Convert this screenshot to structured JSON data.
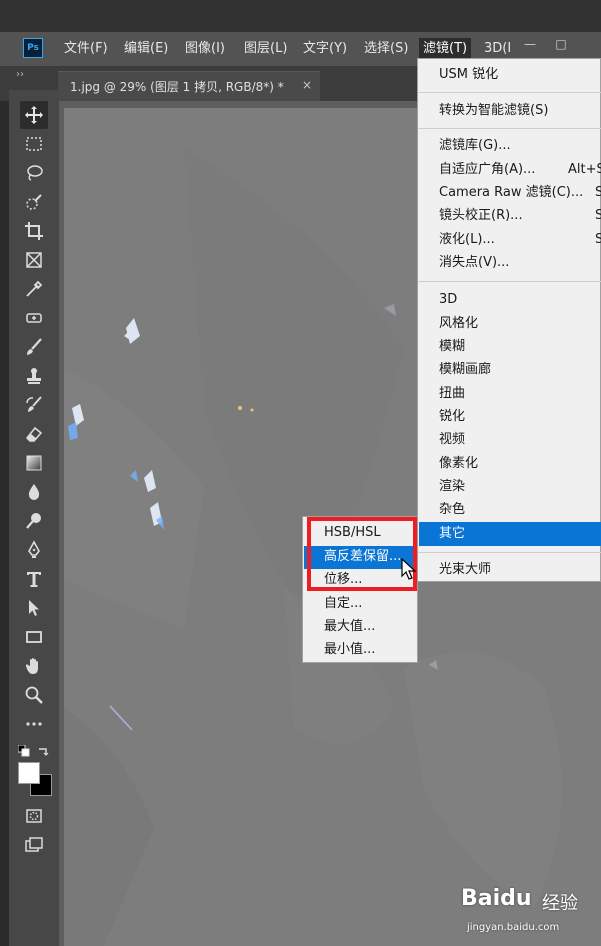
{
  "app": {
    "logo": "Ps",
    "menubar": [
      {
        "label": "文件(F)"
      },
      {
        "label": "编辑(E)"
      },
      {
        "label": "图像(I)"
      },
      {
        "label": "图层(L)"
      },
      {
        "label": "文字(Y)"
      },
      {
        "label": "选择(S)"
      },
      {
        "label": "滤镜(T)"
      },
      {
        "label": "3D(I"
      }
    ],
    "window_buttons": {
      "minimize": "—",
      "restore": "□"
    },
    "collapse_glyph": "››"
  },
  "document_tab": {
    "title": "1.jpg @ 29% (图层 1 拷贝, RGB/8*) *",
    "close": "×"
  },
  "toolbar": {
    "tools": [
      {
        "name": "move-tool-icon",
        "selected": true
      },
      {
        "name": "marquee-tool-icon"
      },
      {
        "name": "lasso-tool-icon"
      },
      {
        "name": "quick-select-tool-icon"
      },
      {
        "name": "crop-tool-icon"
      },
      {
        "name": "frame-tool-icon"
      },
      {
        "name": "eyedropper-tool-icon"
      },
      {
        "name": "healing-brush-tool-icon"
      },
      {
        "name": "brush-tool-icon"
      },
      {
        "name": "clone-stamp-tool-icon"
      },
      {
        "name": "history-brush-tool-icon"
      },
      {
        "name": "eraser-tool-icon"
      },
      {
        "name": "gradient-tool-icon"
      },
      {
        "name": "blur-tool-icon"
      },
      {
        "name": "dodge-tool-icon"
      },
      {
        "name": "pen-tool-icon"
      },
      {
        "name": "type-tool-icon"
      },
      {
        "name": "path-select-tool-icon"
      },
      {
        "name": "rectangle-tool-icon"
      },
      {
        "name": "hand-tool-icon"
      },
      {
        "name": "zoom-tool-icon"
      },
      {
        "name": "more-tools-icon"
      }
    ],
    "colors": {
      "foreground": "#ffffff",
      "background": "#000000"
    }
  },
  "filter_menu": {
    "items": [
      {
        "label": "USM 锐化"
      },
      {
        "label": "转换为智能滤镜(S)"
      },
      {
        "label": "滤镜库(G)..."
      },
      {
        "label": "自适应广角(A)...",
        "shortcut": "Alt+S"
      },
      {
        "label": "Camera Raw 滤镜(C)...",
        "shortcut": "S"
      },
      {
        "label": "镜头校正(R)...",
        "shortcut": "S"
      },
      {
        "label": "液化(L)...",
        "shortcut": "S"
      },
      {
        "label": "消失点(V)..."
      },
      {
        "label": "3D"
      },
      {
        "label": "风格化"
      },
      {
        "label": "模糊"
      },
      {
        "label": "模糊画廊"
      },
      {
        "label": "扭曲"
      },
      {
        "label": "锐化"
      },
      {
        "label": "视频"
      },
      {
        "label": "像素化"
      },
      {
        "label": "渲染"
      },
      {
        "label": "杂色"
      },
      {
        "label": "其它",
        "highlighted": true
      },
      {
        "label": "光束大师"
      }
    ]
  },
  "other_submenu": {
    "items": [
      {
        "label": "HSB/HSL"
      },
      {
        "label": "高反差保留...",
        "highlighted": true
      },
      {
        "label": "位移..."
      },
      {
        "label": "自定..."
      },
      {
        "label": "最大值..."
      },
      {
        "label": "最小值..."
      }
    ]
  },
  "watermark": {
    "brand": "Baidu",
    "suffix": "经验",
    "url": "jingyan.baidu.com"
  },
  "colors": {
    "highlight": "#0b75d6",
    "annotation_red": "#ee1d23",
    "menubar": "#535353",
    "canvas": "#7b7b7b"
  }
}
